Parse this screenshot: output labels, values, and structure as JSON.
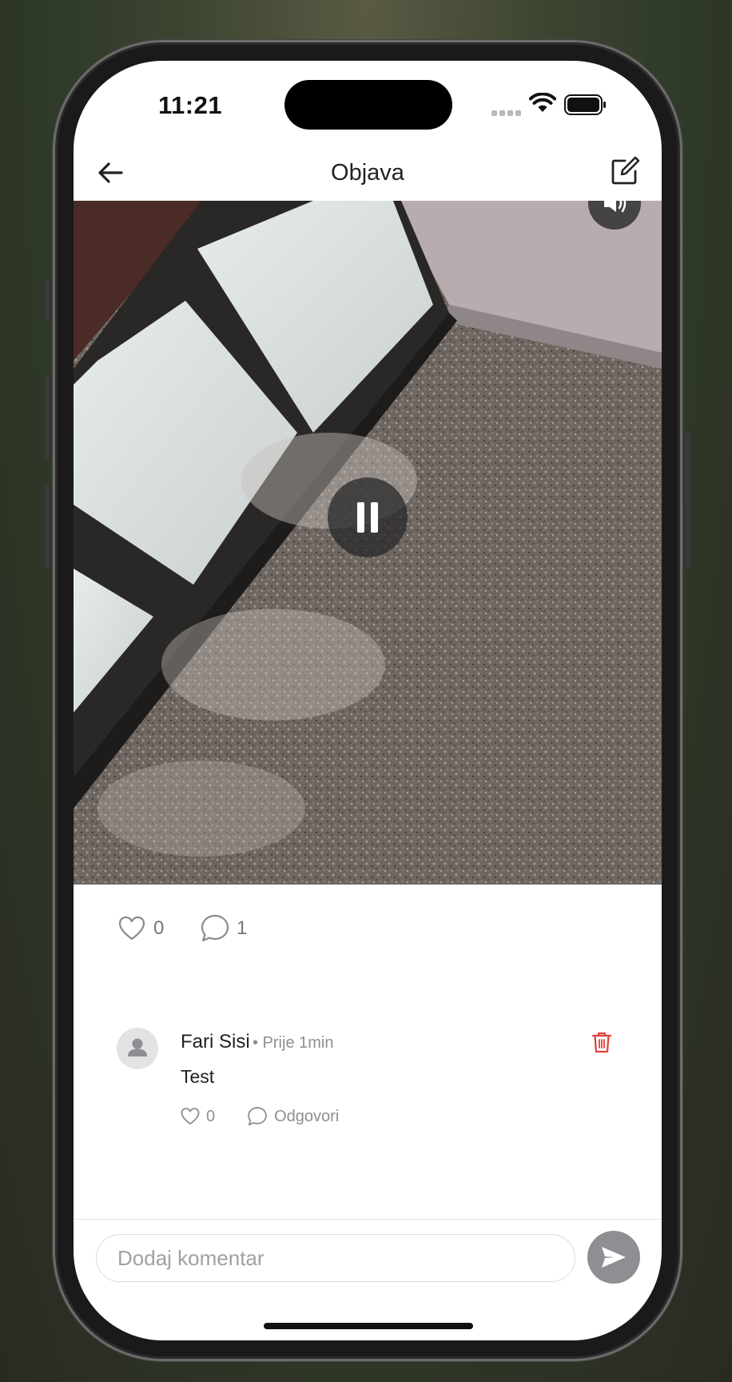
{
  "status_bar": {
    "time": "11:21"
  },
  "nav": {
    "title": "Objava"
  },
  "post": {
    "likes": "0",
    "comments": "1"
  },
  "comment": {
    "author": "Fari Sisi",
    "meta": "• Prije 1min",
    "text": "Test",
    "likes": "0",
    "reply_label": "Odgovori"
  },
  "composer": {
    "placeholder": "Dodaj komentar"
  },
  "colors": {
    "danger": "#e0413a",
    "muted": "#8e8e93",
    "send": "#8e8e93"
  },
  "icons": [
    "back-arrow-icon",
    "edit-icon",
    "sound-icon",
    "pause-icon",
    "heart-icon",
    "comment-bubble-icon",
    "trash-icon",
    "send-icon",
    "avatar-icon"
  ]
}
